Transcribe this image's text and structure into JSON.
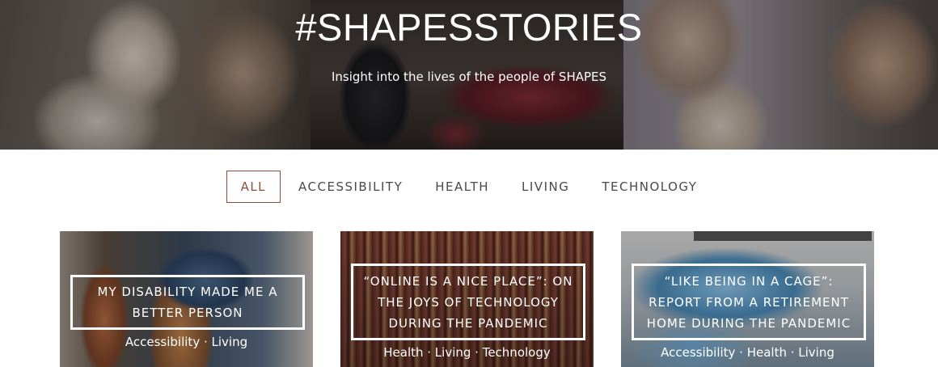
{
  "hero": {
    "title": "#SHAPESSTORIES",
    "subtitle": "Insight into the lives of the people of SHAPES"
  },
  "filters": [
    {
      "label": "ALL",
      "active": true
    },
    {
      "label": "ACCESSIBILITY",
      "active": false
    },
    {
      "label": "HEALTH",
      "active": false
    },
    {
      "label": "LIVING",
      "active": false
    },
    {
      "label": "TECHNOLOGY",
      "active": false
    }
  ],
  "cards": [
    {
      "title": "MY DISABILITY MADE ME A BETTER PERSON",
      "tags": "Accessibility · Living"
    },
    {
      "title": "“ONLINE IS A NICE PLACE”: ON THE JOYS OF TECHNOLOGY DURING THE PANDEMIC",
      "tags": "Health · Living · Technology"
    },
    {
      "title": "“LIKE BEING IN A CAGE”: REPORT FROM A RETIREMENT HOME DURING THE PANDEMIC",
      "tags": "Accessibility · Health · Living"
    }
  ]
}
